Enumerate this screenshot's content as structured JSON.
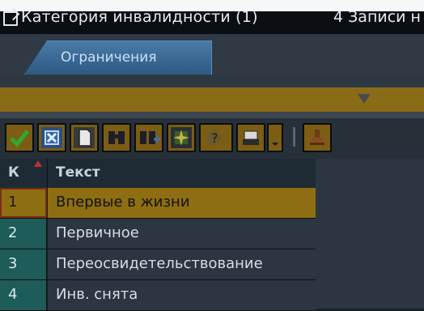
{
  "titlebar": {
    "title": "Категория инвалидности (1)",
    "records": "4 Записи н"
  },
  "tabs": [
    {
      "label": "Ограничения",
      "active": true
    }
  ],
  "toolbar": {
    "buttons": [
      {
        "name": "confirm",
        "icon": "checkmark-icon"
      },
      {
        "name": "cancel",
        "icon": "close-box-icon"
      },
      {
        "name": "new",
        "icon": "document-icon"
      },
      {
        "name": "find",
        "icon": "binoculars-icon"
      },
      {
        "name": "find-next",
        "icon": "binoculars-plus-icon"
      },
      {
        "name": "filter",
        "icon": "sparkle-icon"
      },
      {
        "name": "help",
        "icon": "help-icon"
      },
      {
        "name": "print",
        "icon": "printer-icon"
      },
      {
        "name": "print-options",
        "icon": "dropdown-icon"
      },
      {
        "name": "stamp",
        "icon": "stamp-icon"
      }
    ]
  },
  "grid": {
    "columns": [
      "К",
      "Текст"
    ],
    "rows": [
      {
        "k": "1",
        "text": "Впервые в жизни",
        "selected": true
      },
      {
        "k": "2",
        "text": "Первичное",
        "selected": false
      },
      {
        "k": "3",
        "text": "Переосвидетельствование",
        "selected": false
      },
      {
        "k": "4",
        "text": "Инв. снята",
        "selected": false
      }
    ]
  },
  "colors": {
    "selection": "#8e6e12",
    "key_column": "#1d5c58",
    "tab": "#3a6a97",
    "accent_yellow": "#8a6b18"
  }
}
